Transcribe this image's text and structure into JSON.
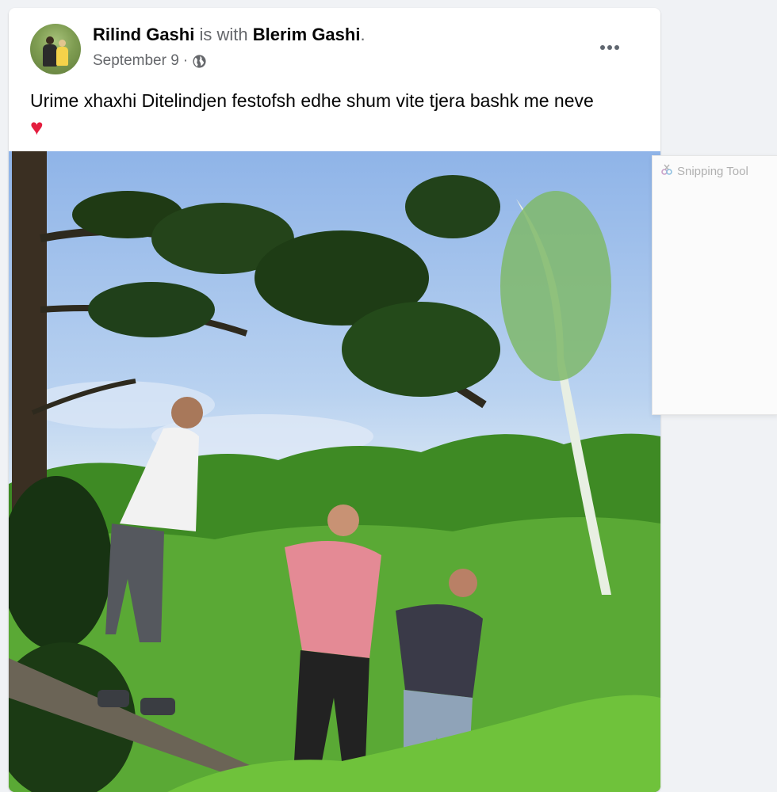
{
  "post": {
    "author": "Rilind Gashi",
    "with_text": "is with",
    "tagged": "Blerim Gashi",
    "period": ".",
    "date": "September 9",
    "separator": "·",
    "privacy_icon": "globe-icon",
    "message": "Urime xhaxhi Ditelindjen festofsh edhe shum vite tjera bashk me neve",
    "emoji": "♥",
    "more_icon": "more-options-icon"
  },
  "snipping_tool": {
    "title": "Snipping Tool"
  },
  "colors": {
    "author": "#050505",
    "secondary": "#65676b",
    "heart": "#e41e3f",
    "background": "#f0f2f5"
  }
}
